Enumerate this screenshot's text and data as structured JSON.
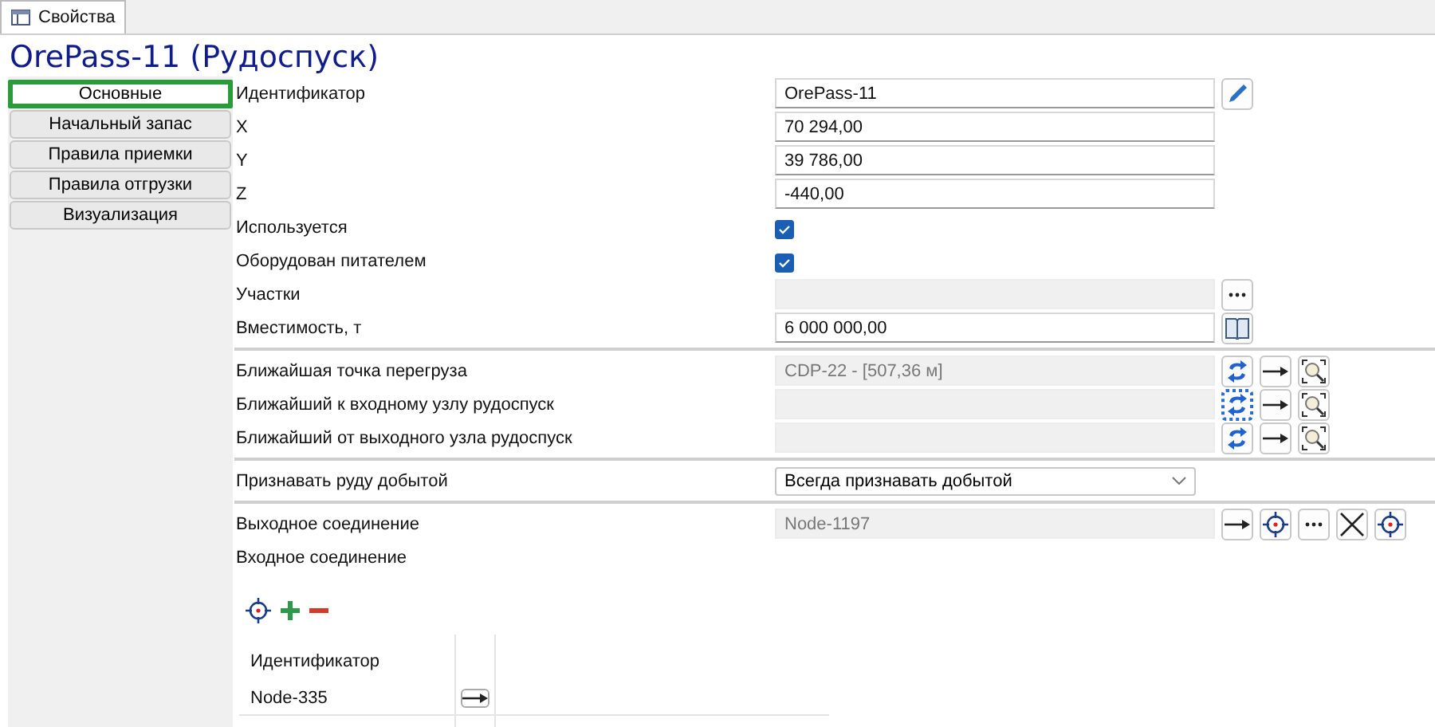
{
  "tab": {
    "label": "Свойства",
    "selected": true
  },
  "title": "OrePass-11 (Рудоспуск)",
  "nav": [
    {
      "label": "Основные",
      "selected": true
    },
    {
      "label": "Начальный запас",
      "selected": false
    },
    {
      "label": "Правила приемки",
      "selected": false
    },
    {
      "label": "Правила отгрузки",
      "selected": false
    },
    {
      "label": "Визуализация",
      "selected": false
    }
  ],
  "sections": [
    {
      "rows": [
        {
          "label": "Идентификатор",
          "kind": "field",
          "value": "OrePass-11",
          "disabled": false,
          "actions": [
            {
              "kind": "edit",
              "focused": false
            }
          ]
        },
        {
          "label": "X",
          "kind": "field",
          "value": "70 294,00",
          "disabled": false,
          "actions": []
        },
        {
          "label": "Y",
          "kind": "field",
          "value": "39 786,00",
          "disabled": false,
          "actions": []
        },
        {
          "label": "Z",
          "kind": "field",
          "value": "-440,00",
          "disabled": false,
          "actions": []
        },
        {
          "label": "Используется",
          "kind": "checkbox",
          "checked": true
        },
        {
          "label": "Оборудован питателем",
          "kind": "checkbox",
          "checked": true
        },
        {
          "label": "Участки",
          "kind": "field",
          "disabled": true,
          "actions": [
            {
              "kind": "more",
              "focused": false
            }
          ]
        },
        {
          "label": "Вместимость, т",
          "kind": "field",
          "value": "6 000 000,00",
          "disabled": false,
          "actions": [
            {
              "kind": "book",
              "focused": false
            }
          ]
        }
      ]
    },
    {
      "rows": [
        {
          "label": "Ближайшая точка перегруза",
          "kind": "field",
          "value": "CDP-22 - [507,36 м]",
          "disabled": true,
          "actions": [
            {
              "kind": "refresh",
              "focused": false
            },
            {
              "kind": "arrow",
              "focused": false
            },
            {
              "kind": "zoom",
              "focused": false
            }
          ]
        },
        {
          "label": "Ближайший к входному узлу рудоспуск",
          "kind": "field",
          "disabled": true,
          "actions": [
            {
              "kind": "refresh",
              "focused": true
            },
            {
              "kind": "arrow",
              "focused": false
            },
            {
              "kind": "zoom",
              "focused": false
            }
          ]
        },
        {
          "label": "Ближайший от выходного узла рудоспуск",
          "kind": "field",
          "disabled": true,
          "actions": [
            {
              "kind": "refresh",
              "focused": false
            },
            {
              "kind": "arrow",
              "focused": false
            },
            {
              "kind": "zoom",
              "focused": false
            }
          ]
        }
      ]
    },
    {
      "rows": [
        {
          "label": "Признавать руду добытой",
          "kind": "dropdown",
          "value": "Всегда признавать добытой"
        }
      ]
    },
    {
      "rows": [
        {
          "label": "Выходное соединение",
          "kind": "field",
          "value": "Node-1197",
          "disabled": true,
          "actions": [
            {
              "kind": "arrow",
              "focused": false
            },
            {
              "kind": "target",
              "focused": false
            },
            {
              "kind": "more",
              "focused": false
            },
            {
              "kind": "delete",
              "focused": false
            },
            {
              "kind": "target",
              "focused": false
            }
          ]
        },
        {
          "label": "Входное соединение",
          "kind": "label"
        }
      ]
    }
  ],
  "input_table": {
    "columns": [
      "Идентификатор"
    ],
    "rows": [
      {
        "cells": [
          "Node-335"
        ]
      }
    ]
  }
}
